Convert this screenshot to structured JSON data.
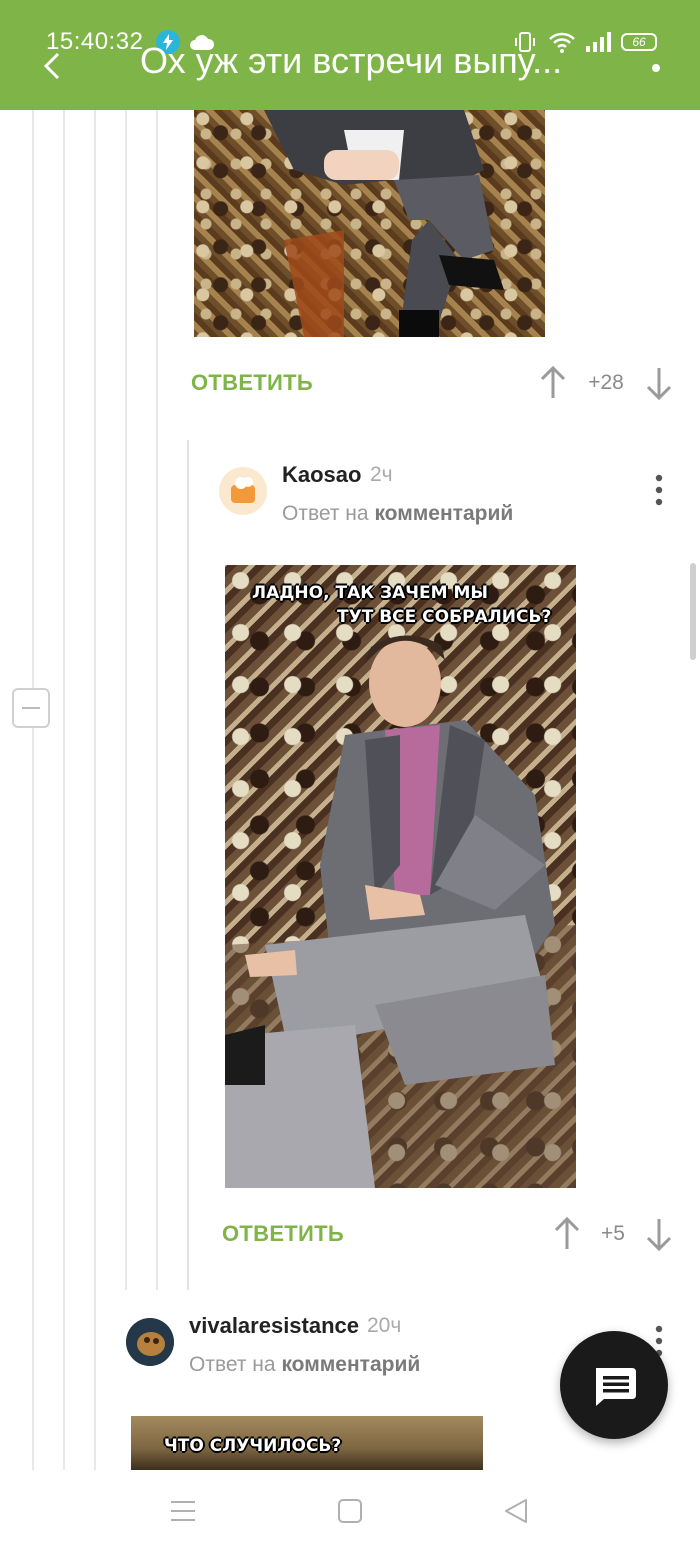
{
  "status_bar": {
    "time": "15:40:32",
    "battery": "66",
    "icons": [
      "charging-bolt-icon",
      "cloud-icon",
      "vibrate-icon",
      "wifi-icon",
      "signal-icon",
      "battery-icon"
    ]
  },
  "app_bar": {
    "title": "Ох уж эти встречи выпу...",
    "back_icon": "back-arrow-icon",
    "menu_icon": "more-vertical-icon",
    "background": "#7fb548"
  },
  "comments": [
    {
      "reply_label": "ОТВЕТИТЬ",
      "rating": "+28"
    },
    {
      "author": "Kaosao",
      "time": "2ч",
      "reply_prefix": "Ответ на",
      "reply_target": "комментарий",
      "meme_caption_line1": "ЛАДНО, ТАК ЗАЧЕМ МЫ",
      "meme_caption_line2": "ТУТ ВСЕ СОБРАЛИСЬ?",
      "reply_label": "ОТВЕТИТЬ",
      "rating": "+5"
    },
    {
      "author": "vivalaresistance",
      "time": "20ч",
      "reply_prefix": "Ответ на",
      "reply_target": "комментарий",
      "meme_caption": "ЧТО СЛУЧИЛОСЬ?"
    }
  ],
  "accent_color": "#7fb548",
  "fab_icon": "comment-icon",
  "nav": [
    "menu-icon",
    "home-square-icon",
    "back-triangle-icon"
  ]
}
